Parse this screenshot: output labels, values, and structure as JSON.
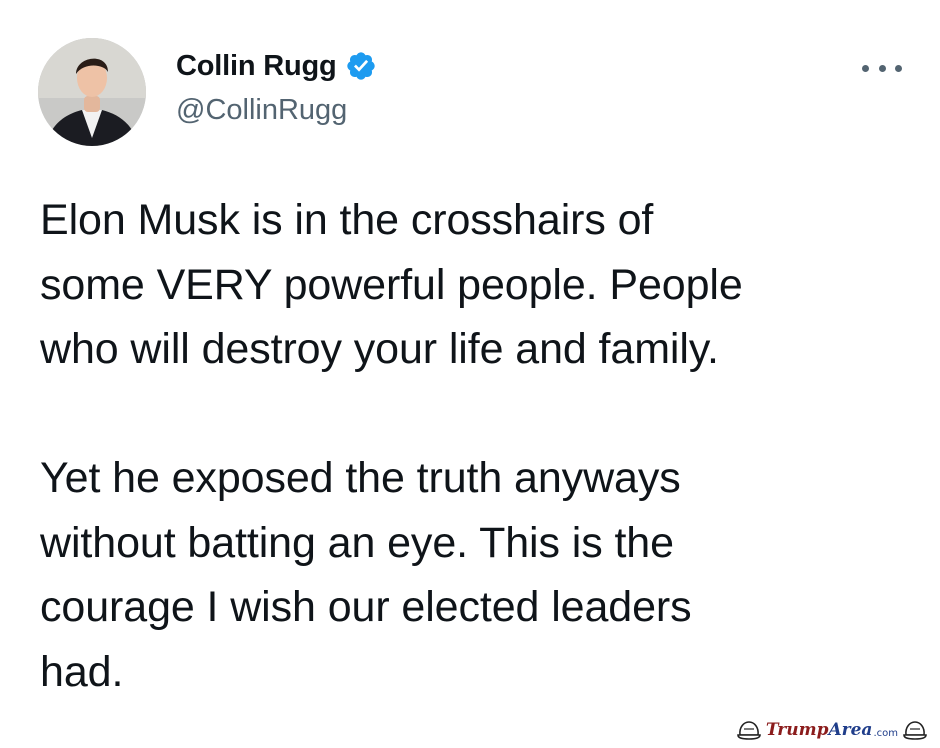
{
  "tweet": {
    "author": {
      "display_name": "Collin Rugg",
      "handle": "@CollinRugg",
      "verified": true,
      "verified_icon": "verified-badge-icon",
      "avatar_icon": "profile-photo"
    },
    "more_icon": "more-options-icon",
    "text": "Elon Musk is in the crosshairs of\nsome VERY powerful people. People\nwho will destroy your life and family.\n\nYet he exposed the truth anyways\nwithout batting an eye. This is the\ncourage I wish our elected leaders\nhad."
  },
  "watermark": {
    "brand_a": "Trump",
    "brand_b": "Area",
    "tld": ".com",
    "logo_icon": "hat-logo-icon"
  },
  "colors": {
    "text": "#0f1419",
    "secondary": "#536471",
    "verified": "#1d9bf0"
  }
}
